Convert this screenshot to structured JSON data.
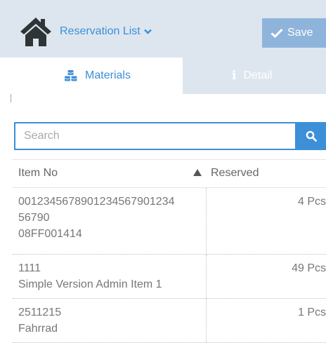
{
  "header": {
    "title": "Reservation List",
    "save_label": "Save",
    "home_icon": "home-icon",
    "colors": {
      "header_bg": "#dde6ee",
      "accent": "#3d8fd8",
      "save_bg": "#8fb4dc"
    }
  },
  "tabs": [
    {
      "label": "Materials",
      "icon": "cubes-icon",
      "active": true
    },
    {
      "label": "Detail",
      "icon": "info-icon",
      "active": false
    }
  ],
  "search": {
    "placeholder": "Search",
    "value": ""
  },
  "table": {
    "columns": [
      {
        "label": "Item No",
        "sort": "ascending"
      },
      {
        "label": "Reserved"
      }
    ],
    "rows": [
      {
        "item_line1": "0012345678901234567901234",
        "item_line2": "56790",
        "item_line3": "08FF001414",
        "reserved": "4 Pcs"
      },
      {
        "item_line1": "1111",
        "item_line2": "Simple Version Admin Item 1",
        "reserved": "49 Pcs"
      },
      {
        "item_line1": "2511215",
        "item_line2": "Fahrrad",
        "reserved": "1 Pcs"
      }
    ]
  }
}
